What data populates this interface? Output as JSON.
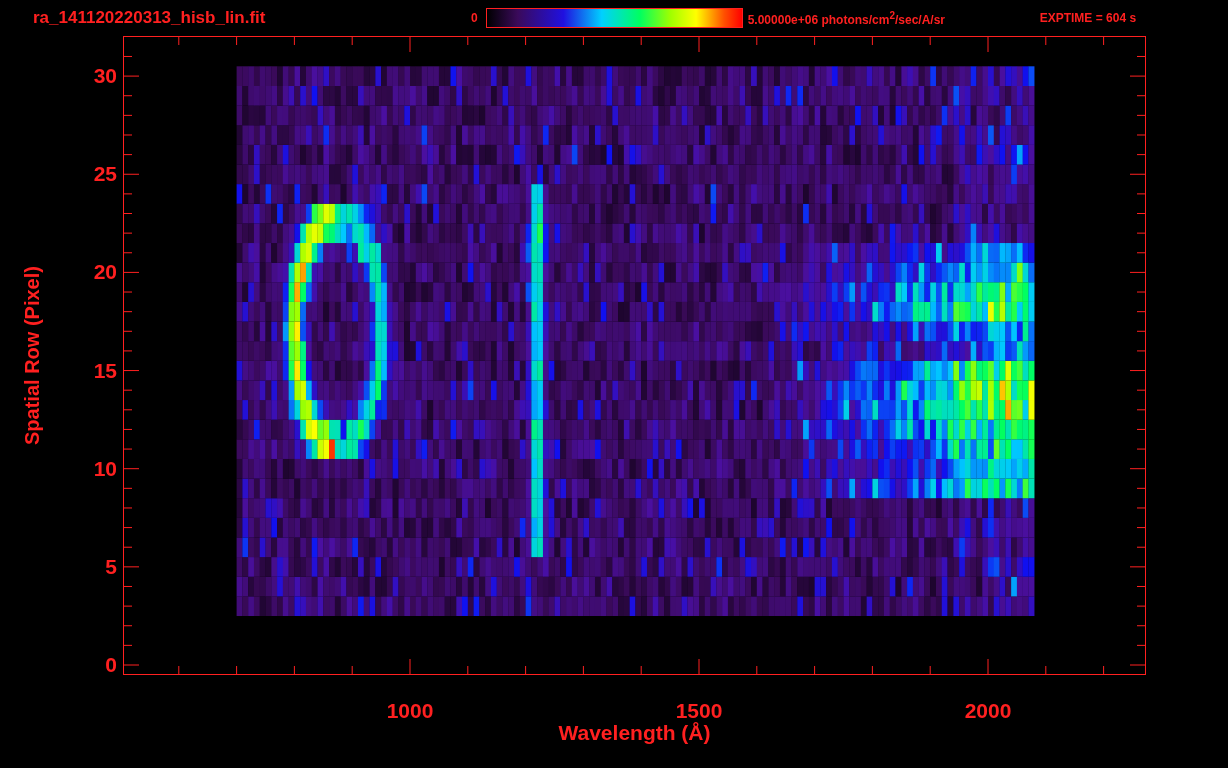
{
  "title": "ra_141120220313_hisb_lin.fit",
  "colorbar": {
    "min_label": "0",
    "max_label": "5.00000e+06 photons/cm$^{2}$/sec/A/sr"
  },
  "exposure": "EXPTIME = 604 s",
  "y_axis": {
    "label": "Spatial Row (Pixel)",
    "ticks": [
      "30",
      "25",
      "20",
      "15",
      "10",
      "5",
      "0"
    ]
  },
  "x_axis": {
    "label": "Wavelength (Å)",
    "ticks": [
      "1000",
      "1500",
      "2000"
    ]
  }
}
